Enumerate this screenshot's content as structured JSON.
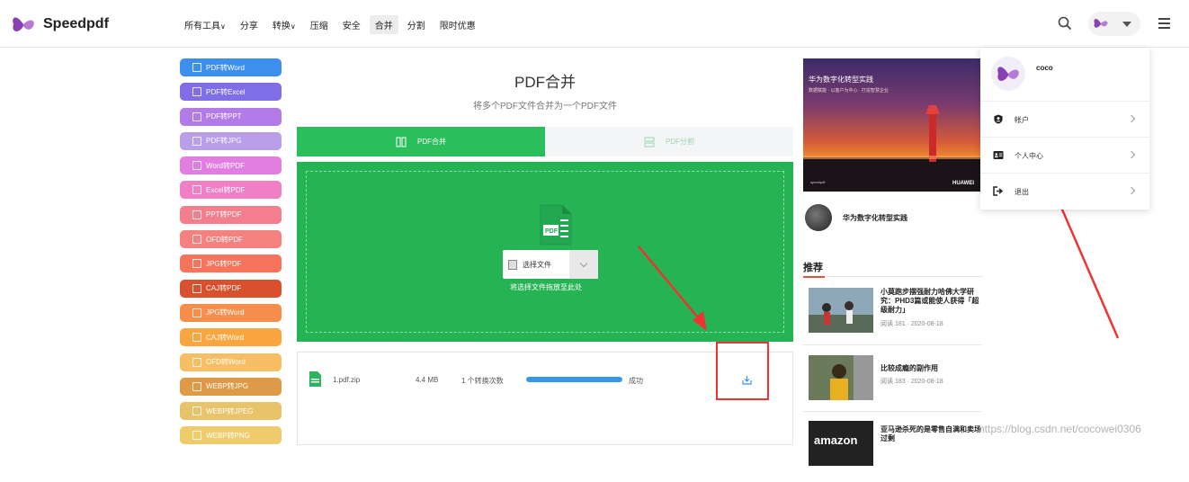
{
  "brand": {
    "name": "Speedpdf",
    "accent": "#7b3fa0"
  },
  "nav": {
    "items": [
      {
        "label": "所有工具",
        "has_caret": true
      },
      {
        "label": "分享",
        "has_caret": false
      },
      {
        "label": "转换",
        "has_caret": true
      },
      {
        "label": "压缩",
        "has_caret": false
      },
      {
        "label": "安全",
        "has_caret": false
      },
      {
        "label": "合并",
        "has_caret": false,
        "active": true
      },
      {
        "label": "分割",
        "has_caret": false
      },
      {
        "label": "限时优惠",
        "has_caret": false
      }
    ],
    "caret_glyph": "∨"
  },
  "sidebar": {
    "tools": [
      {
        "label": "PDF转Word",
        "color": "#3d8fef"
      },
      {
        "label": "PDF转Excel",
        "color": "#7f6ee6"
      },
      {
        "label": "PDF转PPT",
        "color": "#b27be7"
      },
      {
        "label": "PDF转JPG",
        "color": "#b99ee9"
      },
      {
        "label": "Word转PDF",
        "color": "#e27de1"
      },
      {
        "label": "Excel转PDF",
        "color": "#f07fc6"
      },
      {
        "label": "PPT转PDF",
        "color": "#f37f8c"
      },
      {
        "label": "OFD转PDF",
        "color": "#f5817f"
      },
      {
        "label": "JPG转PDF",
        "color": "#f5745b"
      },
      {
        "label": "CAJ转PDF",
        "color": "#d9502e"
      },
      {
        "label": "JPG转Word",
        "color": "#f88e4c"
      },
      {
        "label": "CAJ转Word",
        "color": "#f9a641"
      },
      {
        "label": "OFD转Word",
        "color": "#f8be63"
      },
      {
        "label": "WEBP转JPG",
        "color": "#de9a46"
      },
      {
        "label": "WEBP转JPEG",
        "color": "#e9c36a"
      },
      {
        "label": "WEBP转PNG",
        "color": "#eecc6c"
      }
    ]
  },
  "main": {
    "title": "PDF合并",
    "subtitle": "将多个PDF文件合并为一个PDF文件",
    "tabs": [
      {
        "label": "PDF合并",
        "active": true
      },
      {
        "label": "PDF分割",
        "active": false
      }
    ],
    "drop_zone": {
      "icon_text": "PDF",
      "select_label": "选择文件",
      "hint": "将选择文件拖放至此处"
    },
    "file": {
      "name": "1.pdf.zip",
      "size": "4.4 MB",
      "count": "1 个转换次数",
      "progress": 1.0,
      "status": "成功"
    },
    "green": "#26b354"
  },
  "right": {
    "banner": {
      "title": "华为数字化转型实践",
      "subtitle": "数据赋能 · 以客户为中心 · 打造智慧企业",
      "brand": "HUAWEI",
      "small": "speedpdf"
    },
    "author": "华为数字化转型实践",
    "recommend_title": "推荐",
    "articles": [
      {
        "title": "小莫跑步摆强耐力哈佛大学研究：PHD3篇或能使人获得「超级耐力」",
        "reads": "阅读 181",
        "date": "2020-08-18"
      },
      {
        "title": "比较成瘾的副作用",
        "reads": "阅读 183",
        "date": "2020-08-18"
      },
      {
        "title": "亚马逊杀死的是零售自满和卖场过剩",
        "reads": "",
        "date": ""
      }
    ]
  },
  "user_menu": {
    "name": "coco",
    "items": [
      {
        "label": "帐户",
        "icon": "shield-icon"
      },
      {
        "label": "个人中心",
        "icon": "id-card-icon"
      },
      {
        "label": "退出",
        "icon": "logout-icon"
      }
    ]
  },
  "watermark": "https://blog.csdn.net/cocowei0306"
}
